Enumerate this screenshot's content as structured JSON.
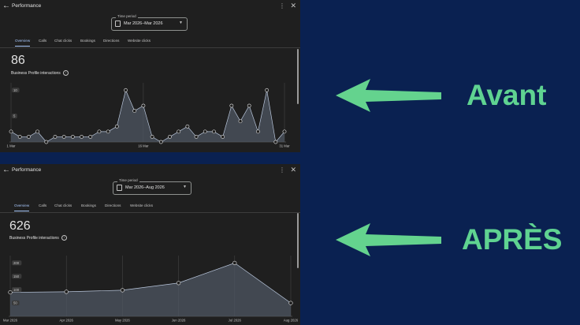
{
  "colors": {
    "background": "#0a2151",
    "panel": "#1f1f1f",
    "accent": "#a8c7fa",
    "arrow": "#64d38e",
    "caption": "#5fd391"
  },
  "before": {
    "header": {
      "back_icon": "arrow-left-icon",
      "title": "Performance",
      "more_icon": "more-vert-icon",
      "close_icon": "close-icon"
    },
    "time_period": {
      "label": "Time period",
      "value": "Mar 2026–Mar 2026"
    },
    "tabs": [
      {
        "label": "Overview",
        "active": true
      },
      {
        "label": "Calls"
      },
      {
        "label": "Chat clicks"
      },
      {
        "label": "Bookings"
      },
      {
        "label": "Directions"
      },
      {
        "label": "Website clicks"
      }
    ],
    "total": "86",
    "metric_label": "Business Profile interactions",
    "chart_data": {
      "type": "area",
      "x": [
        "1 Mar",
        "2 Mar",
        "3 Mar",
        "4 Mar",
        "5 Mar",
        "6 Mar",
        "7 Mar",
        "8 Mar",
        "9 Mar",
        "10 Mar",
        "11 Mar",
        "12 Mar",
        "13 Mar",
        "14 Mar",
        "15 Mar",
        "16 Mar",
        "17 Mar",
        "18 Mar",
        "19 Mar",
        "20 Mar",
        "21 Mar",
        "22 Mar",
        "23 Mar",
        "24 Mar",
        "25 Mar",
        "26 Mar",
        "27 Mar",
        "28 Mar",
        "29 Mar",
        "30 Mar",
        "31 Mar"
      ],
      "values": [
        2,
        1,
        1,
        2,
        0,
        1,
        1,
        1,
        1,
        1,
        2,
        2,
        3,
        10,
        6,
        7,
        1,
        0,
        1,
        2,
        3,
        1,
        2,
        2,
        1,
        7,
        4,
        7,
        2,
        10,
        0,
        2
      ],
      "tick_labels_x": [
        "1 Mar",
        "16 Mar",
        "31 Mar"
      ],
      "tick_labels_y": [
        "10",
        "5"
      ],
      "ylim": [
        0,
        10.5
      ],
      "grid": true
    }
  },
  "after": {
    "header": {
      "back_icon": "arrow-left-icon",
      "title": "Performance",
      "more_icon": "more-vert-icon",
      "close_icon": "close-icon"
    },
    "time_period": {
      "label": "Time period",
      "value": "Mar 2026–Aug 2026"
    },
    "tabs": [
      {
        "label": "Overview",
        "active": true
      },
      {
        "label": "Calls"
      },
      {
        "label": "Chat clicks"
      },
      {
        "label": "Bookings"
      },
      {
        "label": "Directions"
      },
      {
        "label": "Website clicks"
      }
    ],
    "total": "626",
    "metric_label": "Business Profile interactions",
    "chart_data": {
      "type": "area",
      "x": [
        "Mar 2026",
        "Apr 2026",
        "May 2026",
        "Jun 2026",
        "Jul 2026",
        "Aug 2026"
      ],
      "values": [
        90,
        92,
        98,
        125,
        200,
        50
      ],
      "tick_labels_y": [
        "200",
        "150",
        "100",
        "50"
      ],
      "ylim": [
        0,
        210
      ],
      "grid": true
    }
  },
  "captions": {
    "before": "Avant",
    "after": "APRÈS"
  },
  "arrows": {
    "icon": "arrow-left-icon"
  }
}
